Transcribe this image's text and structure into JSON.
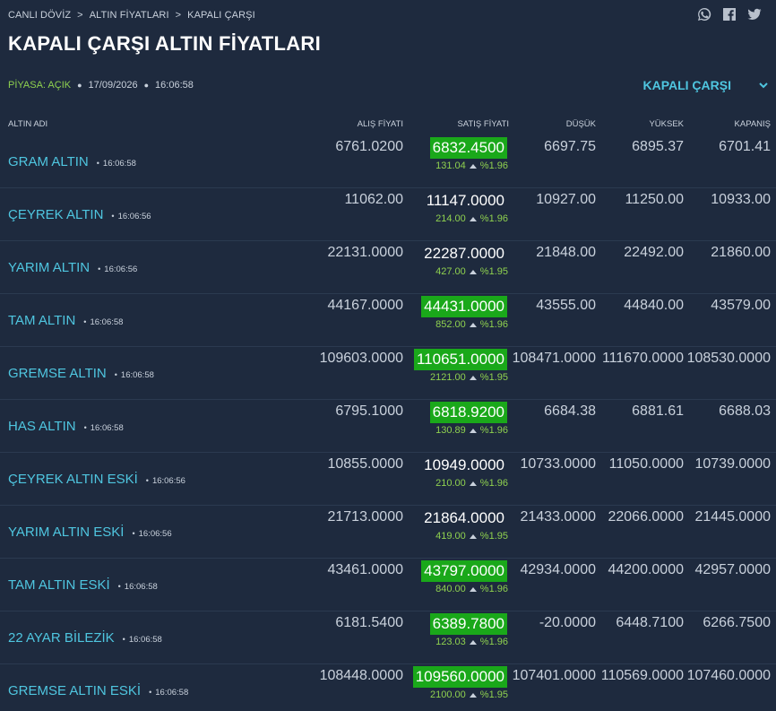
{
  "breadcrumb": [
    "CANLI DÖVİZ",
    "ALTIN FİYATLARI",
    "KAPALI ÇARŞI"
  ],
  "title": "KAPALI ÇARŞI ALTIN FİYATLARI",
  "status": {
    "market_label": "PİYASA: AÇIK",
    "date": "17/09/2026",
    "time": "16:06:58"
  },
  "market_select": {
    "value": "KAPALI ÇARŞI"
  },
  "social_icons": [
    "whatsapp-icon",
    "facebook-icon",
    "twitter-icon"
  ],
  "columns": {
    "name": "ALTIN ADI",
    "bid": "ALIŞ FİYATI",
    "ask": "SATIŞ FİYATI",
    "low": "DÜŞÜK",
    "high": "YÜKSEK",
    "close": "KAPANIŞ"
  },
  "colors": {
    "background": "#1e2a3e",
    "accent": "#4fc6e0",
    "up_highlight": "#1aa81a",
    "positive": "#8fd14f"
  },
  "rows": [
    {
      "name": "GRAM ALTIN",
      "time": "16:06:58",
      "bid": "6761.0200",
      "ask": "6832.4500",
      "highlight": true,
      "change": "131.04",
      "pct": "%1.96",
      "low": "6697.75",
      "high": "6895.37",
      "close": "6701.41"
    },
    {
      "name": "ÇEYREK ALTIN",
      "time": "16:06:56",
      "bid": "11062.00",
      "ask": "11147.0000",
      "highlight": false,
      "change": "214.00",
      "pct": "%1.96",
      "low": "10927.00",
      "high": "11250.00",
      "close": "10933.00"
    },
    {
      "name": "YARIM ALTIN",
      "time": "16:06:56",
      "bid": "22131.0000",
      "ask": "22287.0000",
      "highlight": false,
      "change": "427.00",
      "pct": "%1.95",
      "low": "21848.00",
      "high": "22492.00",
      "close": "21860.00"
    },
    {
      "name": "TAM ALTIN",
      "time": "16:06:58",
      "bid": "44167.0000",
      "ask": "44431.0000",
      "highlight": true,
      "change": "852.00",
      "pct": "%1.96",
      "low": "43555.00",
      "high": "44840.00",
      "close": "43579.00"
    },
    {
      "name": "GREMSE ALTIN",
      "time": "16:06:58",
      "bid": "109603.0000",
      "ask": "110651.0000",
      "highlight": true,
      "change": "2121.00",
      "pct": "%1.95",
      "low": "108471.0000",
      "high": "111670.0000",
      "close": "108530.0000"
    },
    {
      "name": "HAS ALTIN",
      "time": "16:06:58",
      "bid": "6795.1000",
      "ask": "6818.9200",
      "highlight": true,
      "change": "130.89",
      "pct": "%1.96",
      "low": "6684.38",
      "high": "6881.61",
      "close": "6688.03"
    },
    {
      "name": "ÇEYREK ALTIN ESKİ",
      "time": "16:06:56",
      "bid": "10855.0000",
      "ask": "10949.0000",
      "highlight": false,
      "change": "210.00",
      "pct": "%1.96",
      "low": "10733.0000",
      "high": "11050.0000",
      "close": "10739.0000"
    },
    {
      "name": "YARIM ALTIN ESKİ",
      "time": "16:06:56",
      "bid": "21713.0000",
      "ask": "21864.0000",
      "highlight": false,
      "change": "419.00",
      "pct": "%1.95",
      "low": "21433.0000",
      "high": "22066.0000",
      "close": "21445.0000"
    },
    {
      "name": "TAM ALTIN ESKİ",
      "time": "16:06:58",
      "bid": "43461.0000",
      "ask": "43797.0000",
      "highlight": true,
      "change": "840.00",
      "pct": "%1.96",
      "low": "42934.0000",
      "high": "44200.0000",
      "close": "42957.0000"
    },
    {
      "name": "22 AYAR BİLEZİK",
      "time": "16:06:58",
      "bid": "6181.5400",
      "ask": "6389.7800",
      "highlight": true,
      "change": "123.03",
      "pct": "%1.96",
      "low": "-20.0000",
      "high": "6448.7100",
      "close": "6266.7500"
    },
    {
      "name": "GREMSE ALTIN ESKİ",
      "time": "16:06:58",
      "bid": "108448.0000",
      "ask": "109560.0000",
      "highlight": true,
      "change": "2100.00",
      "pct": "%1.95",
      "low": "107401.0000",
      "high": "110569.0000",
      "close": "107460.0000"
    }
  ]
}
